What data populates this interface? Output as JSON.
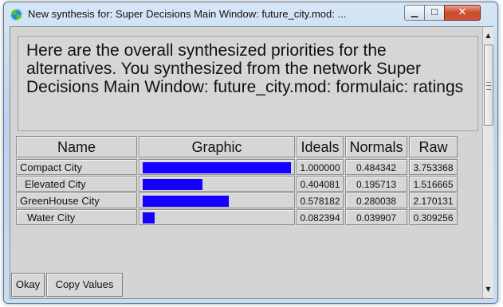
{
  "window": {
    "title": "New synthesis for: Super Decisions Main Window: future_city.mod: ...",
    "icon": "super-decisions-icon",
    "controls": {
      "minimize": "▁",
      "maximize": "☐",
      "close": "✕"
    }
  },
  "message": "Here are the overall synthesized priorities for the alternatives.  You synthesized from the network Super Decisions Main Window: future_city.mod: formulaic: ratings",
  "table": {
    "headers": {
      "name": "Name",
      "graphic": "Graphic",
      "ideals": "Ideals",
      "normals": "Normals",
      "raw": "Raw"
    },
    "bar_color": "#1300ff",
    "rows": [
      {
        "name": "Compact City",
        "ideal": 1.0,
        "ideals": "1.000000",
        "normals": "0.484342",
        "raw": "3.753368"
      },
      {
        "name": "Elevated City",
        "ideal": 0.404081,
        "ideals": "0.404081",
        "normals": "0.195713",
        "raw": "1.516665"
      },
      {
        "name": "GreenHouse City",
        "ideal": 0.578182,
        "ideals": "0.578182",
        "normals": "0.280038",
        "raw": "2.170131"
      },
      {
        "name": "Water City",
        "ideal": 0.082394,
        "ideals": "0.082394",
        "normals": "0.039907",
        "raw": "0.309256"
      }
    ]
  },
  "buttons": {
    "okay": "Okay",
    "copy_values": "Copy Values"
  }
}
